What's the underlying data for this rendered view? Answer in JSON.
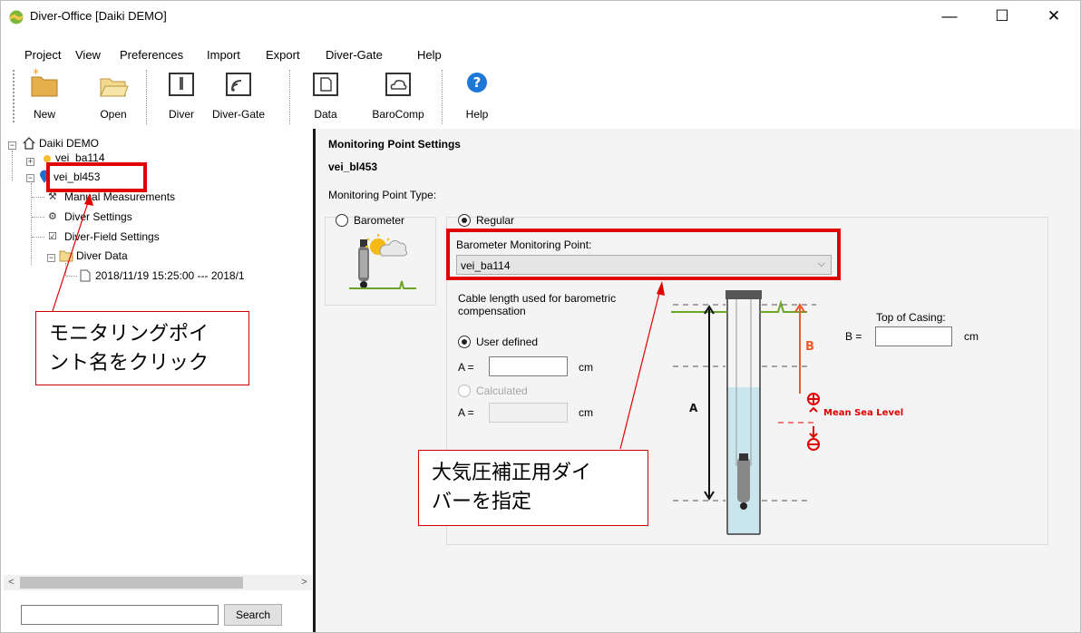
{
  "window": {
    "title": "Diver-Office [Daiki DEMO]",
    "min": "—",
    "max": "☐",
    "close": "✕"
  },
  "menu": [
    "Project",
    "View",
    "Preferences",
    "Import",
    "Export",
    "Diver-Gate",
    "Help"
  ],
  "toolbar": {
    "new": "New",
    "open": "Open",
    "diver": "Diver",
    "divergate": "Diver-Gate",
    "data": "Data",
    "barocomp": "BaroComp",
    "help": "Help"
  },
  "tree": {
    "root": "Daiki DEMO",
    "items": [
      "vei_ba114",
      "vei_bl453",
      "Manual Measurements",
      "Diver Settings",
      "Diver-Field Settings",
      "Diver Data",
      "2018/11/19 15:25:00 --- 2018/1"
    ]
  },
  "search": {
    "value": "",
    "button": "Search"
  },
  "settings": {
    "title": "Monitoring Point Settings",
    "point": "vei_bl453",
    "type_label": "Monitoring Point Type:",
    "barometer": "Barometer",
    "regular": "Regular",
    "baro_point_label": "Barometer Monitoring Point:",
    "baro_point_value": "vei_ba114",
    "cable_label_1": "Cable length used for barometric",
    "cable_label_2": "compensation",
    "user_defined": "User defined",
    "a_eq": "A =",
    "cm": "cm",
    "calculated": "Calculated",
    "top_casing": "Top of Casing:",
    "b_eq": "B =",
    "diagram": {
      "a": "A",
      "b": "B",
      "msl": "Mean Sea Level"
    }
  },
  "annotations": {
    "callout1_line1": "モニタリングポイ",
    "callout1_line2": "ント名をクリック",
    "callout2_line1": "大気圧補正用ダイ",
    "callout2_line2": "バーを指定"
  },
  "colors": {
    "accent_red": "#e00000",
    "water": "#c9e6ee",
    "ground": "#6aa52a",
    "orange": "#f05a28"
  }
}
